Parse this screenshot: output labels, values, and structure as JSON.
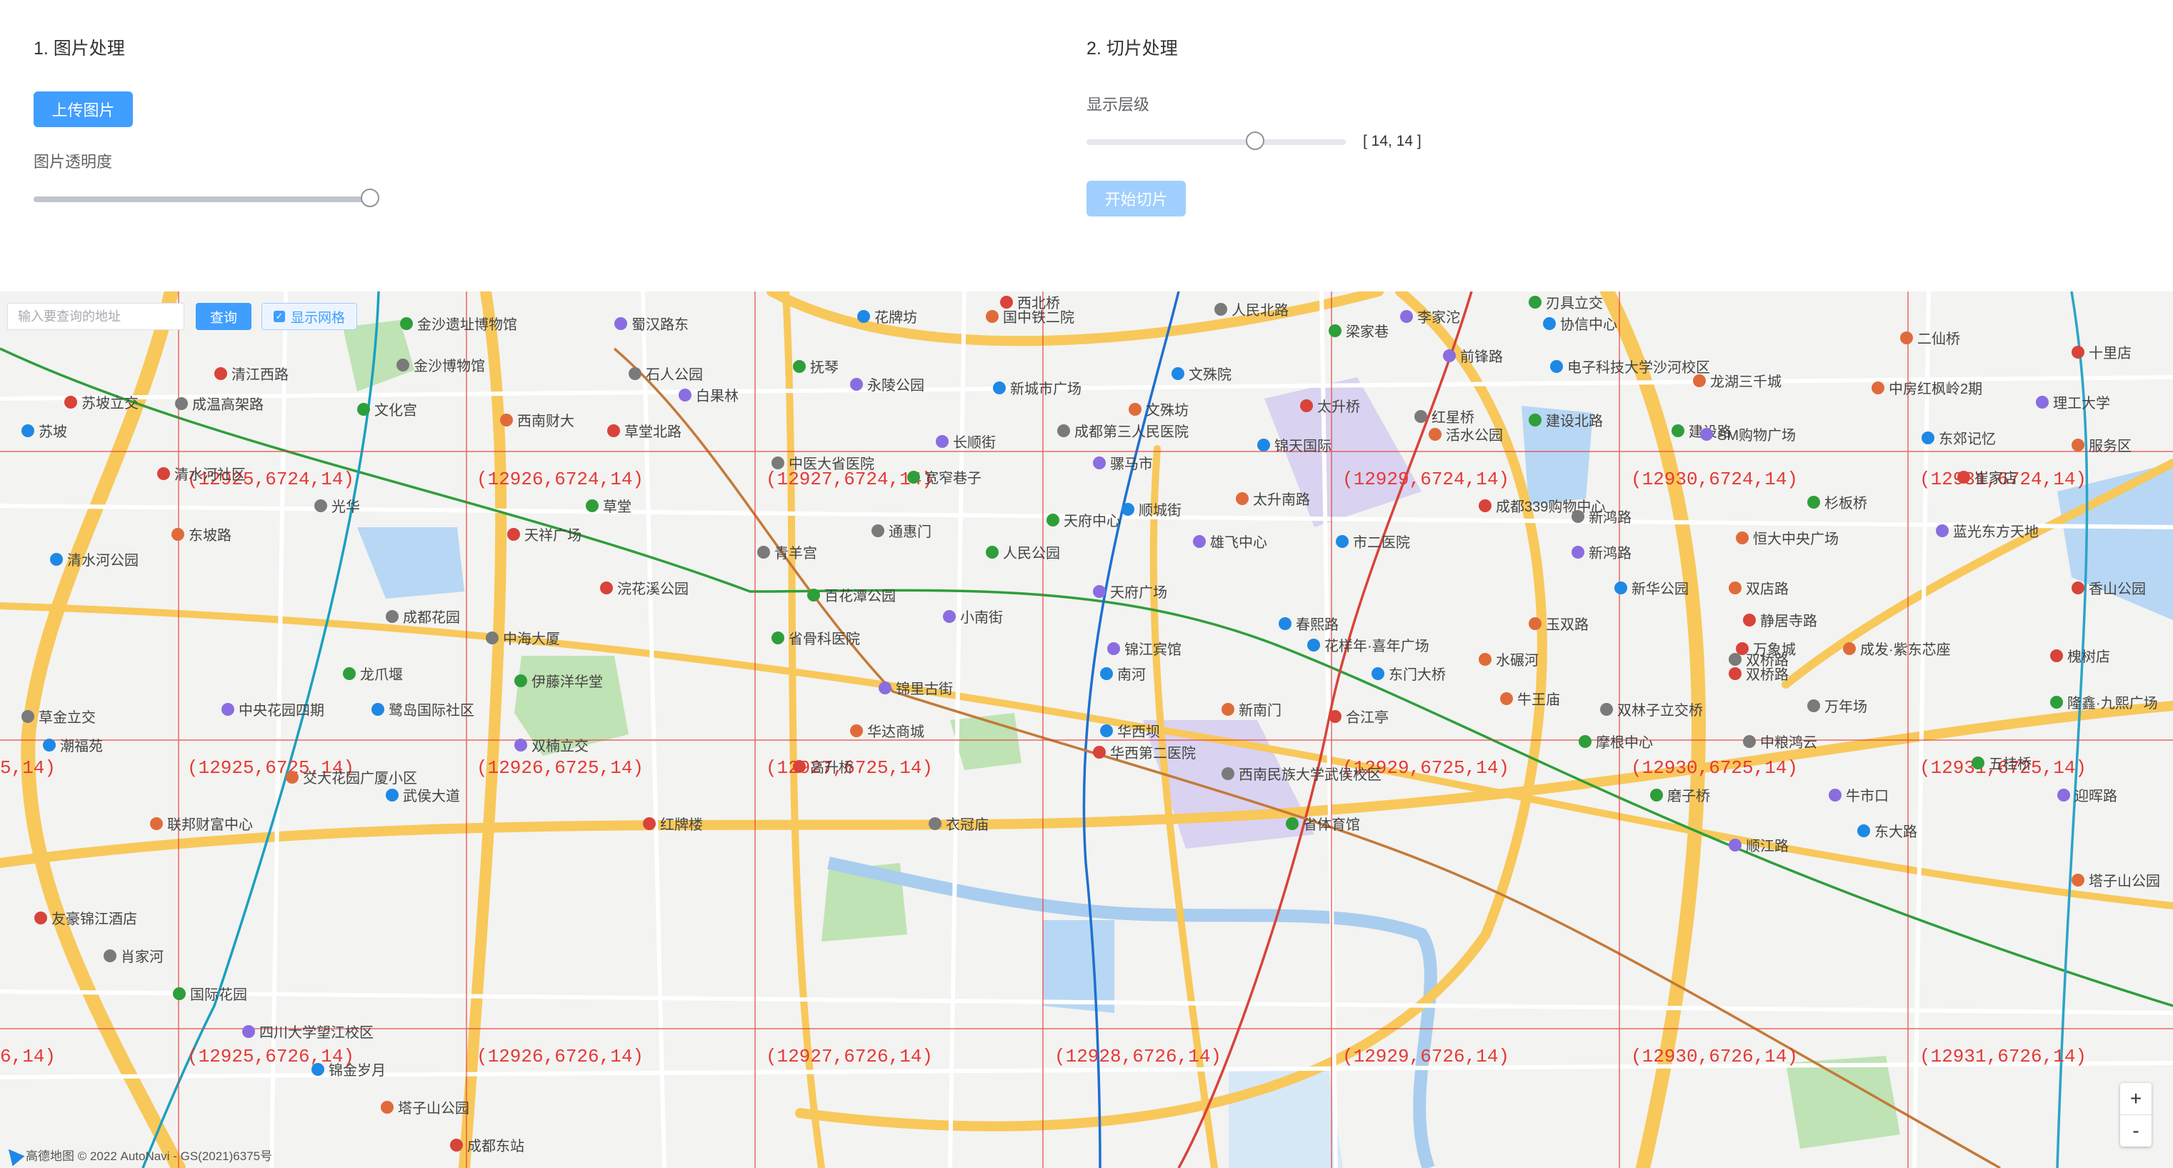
{
  "image_section": {
    "title": "1. 图片处理",
    "upload_button": "上传图片",
    "opacity_label": "图片透明度",
    "opacity_value": 1.0
  },
  "tile_section": {
    "title": "2. 切片处理",
    "level_label": "显示层级",
    "level_range": "[ 14, 14 ]",
    "level_slider_position": 0.67,
    "start_button": "开始切片",
    "start_button_disabled": true
  },
  "map": {
    "search_placeholder": "输入要查询的地址",
    "search_button": "查询",
    "grid_toggle_label": "显示网格",
    "grid_toggle_checked": true,
    "zoom_in": "+",
    "zoom_out": "-",
    "copyright": "高德地图 © 2022 AutoNavi - GS(2021)6375号",
    "tile_labels": [
      "(12925,6724,14)",
      "(12926,6724,14)",
      "(12927,6724,14)",
      "(12929,6724,14)",
      "(12930,6724,14)",
      "(12931,6724,14)",
      "5,14)",
      "(12925,6725,14)",
      "(12926,6725,14)",
      "(12927,6725,14)",
      "(12929,6725,14)",
      "(12930,6725,14)",
      "(12931,6725,14)",
      "6,14)",
      "(12925,6726,14)",
      "(12926,6726,14)",
      "(12927,6726,14)",
      "(12928,6726,14)",
      "(12929,6726,14)",
      "(12930,6726,14)",
      "(12931,6726,14)"
    ],
    "places": [
      "金沙遗址博物馆",
      "蜀汉路东",
      "花牌坊",
      "国中铁二院",
      "西北桥",
      "人民北路",
      "刃具立交",
      "李家沱",
      "协信中心",
      "二仙桥",
      "十里店",
      "金沙博物馆",
      "梁家巷",
      "前锋路",
      "电子科技大学沙河校区",
      "龙湖三千城",
      "清江西路",
      "石人公园",
      "抚琴",
      "永陵公园",
      "文殊院",
      "中房红枫岭2期",
      "苏坡立交",
      "成温高架路",
      "文化宫",
      "白果林",
      "新城市广场",
      "文殊坊",
      "太升桥",
      "红星桥",
      "建设北路",
      "理工大学",
      "苏坡",
      "西南财大",
      "草堂北路",
      "成都第三人民医院",
      "建设路",
      "SM购物广场",
      "东郊记忆",
      "服务区",
      "清水河社区",
      "中医大省医院",
      "宽窄巷子",
      "骡马市",
      "锦天国际",
      "活水公园",
      "崔家店",
      "光华",
      "草堂",
      "长顺街",
      "顺城街",
      "太升南路",
      "成都339购物中心",
      "新鸿路",
      "杉板桥",
      "蓝光东方天地",
      "清水河公园",
      "东坡路",
      "天祥广场",
      "通惠门",
      "天府中心",
      "雄飞中心",
      "市二医院",
      "恒大中央广场",
      "浣花溪公园",
      "青羊宫",
      "人民公园",
      "新鸿路",
      "新华公园",
      "双店路",
      "香山公园",
      "成都花园",
      "百花潭公园",
      "天府广场",
      "春熙路",
      "玉双路",
      "静居寺路",
      "中海大厦",
      "省骨科医院",
      "小南街",
      "花样年·喜年广场",
      "成发·紫东芯座",
      "万象城",
      "双桥路",
      "龙爪堰",
      "锦江宾馆",
      "东门大桥",
      "水碾河",
      "槐树店",
      "草金立交",
      "伊藤洋华堂",
      "锦里古街",
      "南河",
      "牛王庙",
      "双桥路",
      "万年场",
      "隆鑫·九熙广场",
      "中央花园四期",
      "鹭岛国际社区",
      "新南门",
      "合江亭",
      "双林子立交桥",
      "摩根中心",
      "双楠立交",
      "华西坝",
      "华达商城",
      "华西第二医院",
      "中粮鸿云",
      "五桂桥",
      "迎晖路",
      "潮福苑",
      "交大花园广厦小区",
      "高升桥",
      "西南民族大学武侯校区",
      "磨子桥",
      "牛市口",
      "武侯大道",
      "联邦财富中心",
      "红牌楼",
      "衣冠庙",
      "省体育馆",
      "顺江路",
      "东大路",
      "塔子山公园",
      "友豪锦江酒店",
      "肖家河",
      "国际花园",
      "四川大学望江校区",
      "锦金岁月",
      "塔子山公园",
      "成都东站"
    ]
  },
  "colors": {
    "primary": "#409eff",
    "primary_disabled": "#a0cfff",
    "grid_line": "#e53935",
    "road_major": "#f8c85a",
    "metro_line1": "#1e6fd0",
    "metro_line2": "#2e9e3a",
    "metro_line4": "#d8433a",
    "metro_line3": "#c47a38"
  }
}
